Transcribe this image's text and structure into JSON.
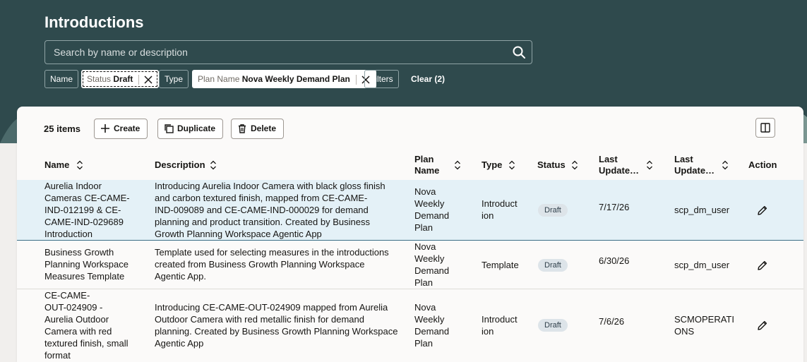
{
  "page": {
    "title": "Introductions",
    "search_placeholder": "Search by name or description"
  },
  "filters": {
    "name": "Name",
    "status_label": "Status",
    "status_value": "Draft",
    "type": "Type",
    "plan_label": "Plan Name",
    "plan_value": "Nova Weekly Demand Plan",
    "filters": "Filters",
    "clear": "Clear (2)"
  },
  "toolbar": {
    "count": "25 items",
    "create": "Create",
    "duplicate": "Duplicate",
    "delete": "Delete"
  },
  "columns": [
    "Name",
    "Description",
    "Plan Name",
    "Type",
    "Status",
    "Last Update…",
    "Last Update…",
    "Action"
  ],
  "rows": [
    {
      "name": [
        "Aurelia Indoor",
        "Cameras CE-CAME-",
        "IND-012199 & CE-",
        "CAME-IND-029689",
        "Introduction"
      ],
      "description": [
        "Introducing Aurelia Indoor Camera with black gloss finish",
        "and carbon textured finish, mapped from CE-CAME-",
        "IND-009089 and CE-CAME-IND-000029 for demand",
        "planning and product transition. Created by Business",
        "Growth Planning Workspace Agentic App"
      ],
      "plan": [
        "Nova",
        "Weekly",
        "Demand",
        "Plan"
      ],
      "type": [
        "Introduct",
        "ion"
      ],
      "status": "Draft",
      "date": "7/17/26",
      "user": [
        "scp_dm_user"
      ]
    },
    {
      "name": [
        "Business Growth",
        "Planning Workspace",
        "Measures Template"
      ],
      "description": [
        "Template used for selecting measures in the introductions",
        "created from Business Growth Planning Workspace",
        "Agentic App."
      ],
      "plan": [
        "Nova",
        "Weekly",
        "Demand",
        "Plan"
      ],
      "type": [
        "Template"
      ],
      "status": "Draft",
      "date": "6/30/26",
      "user": [
        "scp_dm_user"
      ]
    },
    {
      "name": [
        "CE-CAME-",
        "OUT-024909 -",
        "Aurelia Outdoor",
        "Camera with red",
        "textured finish, small",
        "format"
      ],
      "description": [
        "Introducing CE-CAME-OUT-024909 mapped from Aurelia",
        "Outdoor Camera with red metallic finish for demand",
        "planning. Created by Business Growth Planning Workspace",
        "Agentic App"
      ],
      "plan": [
        "Nova",
        "Weekly",
        "Demand",
        "Plan"
      ],
      "type": [
        "Introduct",
        "ion"
      ],
      "status": "Draft",
      "date": "7/6/26",
      "user": [
        "SCMOPERATI",
        "ONS"
      ]
    }
  ]
}
